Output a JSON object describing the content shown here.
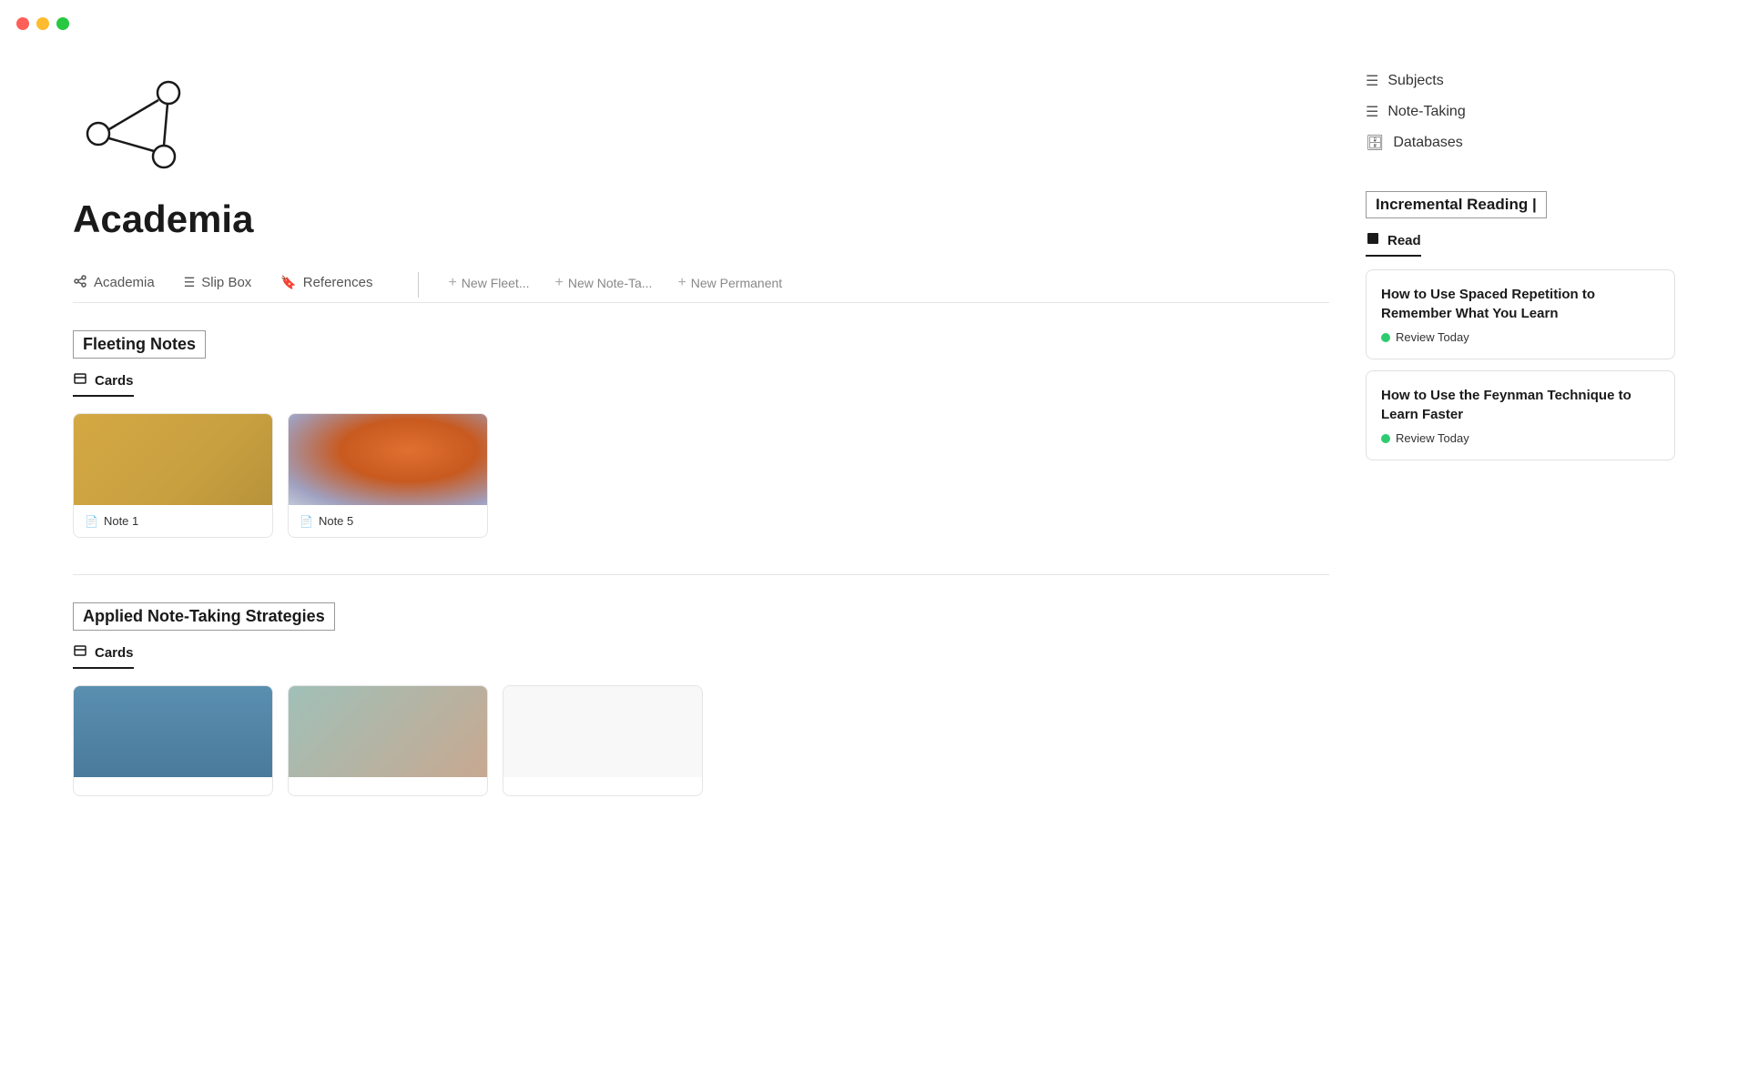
{
  "titlebar": {
    "traffic_lights": [
      "red",
      "yellow",
      "green"
    ]
  },
  "page": {
    "title": "Academia"
  },
  "tabs": {
    "items": [
      {
        "id": "academia",
        "label": "Academia",
        "icon": "⋯"
      },
      {
        "id": "slipbox",
        "label": "Slip Box",
        "icon": "☰"
      },
      {
        "id": "references",
        "label": "References",
        "icon": "🔖"
      }
    ],
    "actions": [
      {
        "id": "new-fleet",
        "label": "New Fleet..."
      },
      {
        "id": "new-note-ta",
        "label": "New Note-Ta..."
      },
      {
        "id": "new-permanent",
        "label": "New Permanent"
      }
    ]
  },
  "fleeting_notes": {
    "heading": "Fleeting Notes",
    "tab_label": "Cards",
    "cards": [
      {
        "id": "note1",
        "label": "Note 1",
        "cover": "warm"
      },
      {
        "id": "note5",
        "label": "Note 5",
        "cover": "orange-blue"
      }
    ]
  },
  "applied_notes": {
    "heading": "Applied Note-Taking Strategies",
    "tab_label": "Cards",
    "cards": [
      {
        "id": "applied1",
        "label": "",
        "cover": "blue"
      },
      {
        "id": "applied2",
        "label": "",
        "cover": "teal-peach"
      },
      {
        "id": "applied3",
        "label": "",
        "cover": "white"
      }
    ]
  },
  "sidebar": {
    "links": [
      {
        "id": "subjects",
        "label": "Subjects",
        "icon": "☰"
      },
      {
        "id": "note-taking",
        "label": "Note-Taking",
        "icon": "☰"
      },
      {
        "id": "databases",
        "label": "Databases",
        "icon": "🗄"
      }
    ],
    "incremental_reading": {
      "heading": "Incremental Reading",
      "pipe": "|",
      "read_tab": "Read",
      "cards": [
        {
          "id": "card1",
          "title": "How to Use Spaced Repetition to Remember What You Learn",
          "status": "Review Today"
        },
        {
          "id": "card2",
          "title": "How to Use the Feynman Technique to Learn Faster",
          "status": "Review Today"
        }
      ]
    }
  }
}
